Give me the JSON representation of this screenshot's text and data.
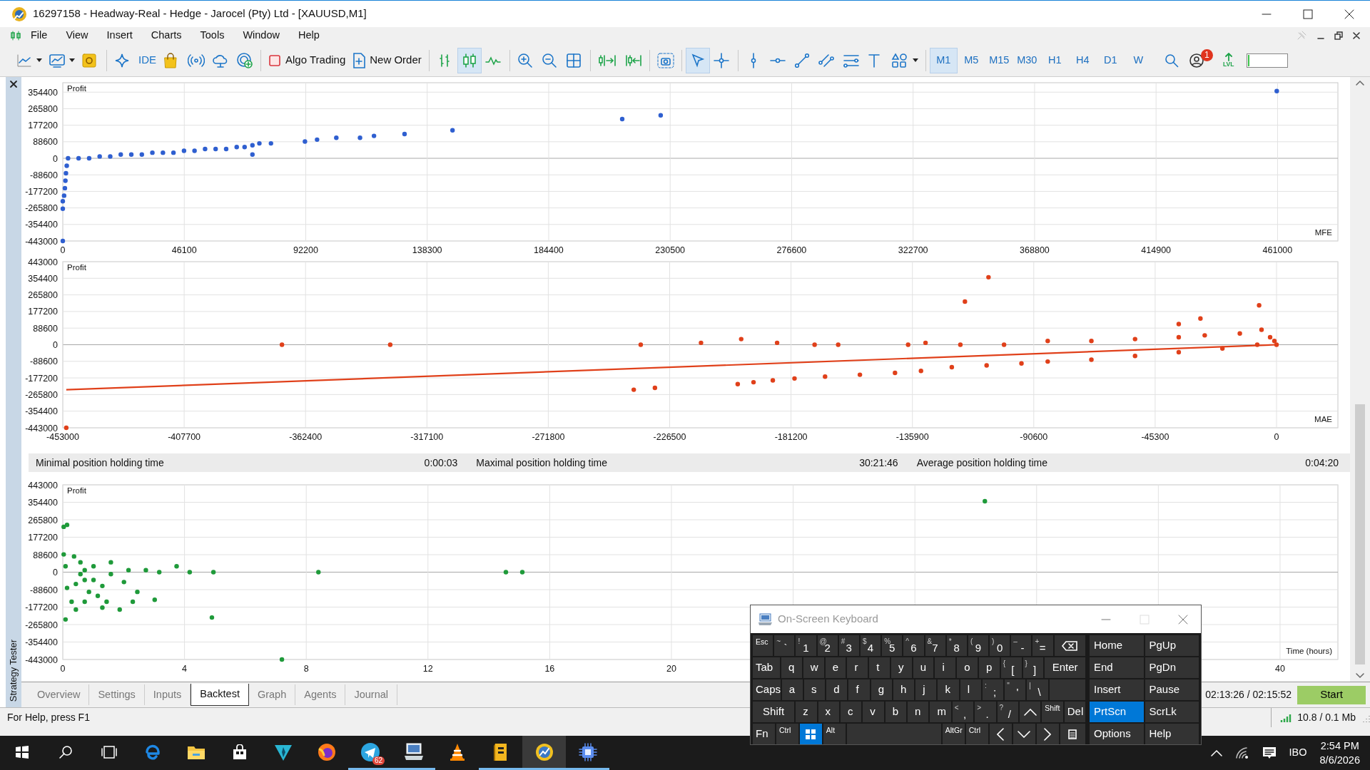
{
  "window": {
    "title": "16297158 - Headway-Real - Hedge - Jarocel (Pty) Ltd - [XAUUSD,M1]"
  },
  "menu": [
    "File",
    "View",
    "Insert",
    "Charts",
    "Tools",
    "Window",
    "Help"
  ],
  "toolbar": {
    "ide": "IDE",
    "algo_trading": {
      "label": "Algo Trading",
      "enabled": false
    },
    "new_order": "New Order",
    "chart_types": [
      {
        "selected": false
      },
      {
        "selected": true
      },
      {
        "selected": false
      }
    ],
    "cursor_tools": [
      {
        "selected": true
      },
      {
        "selected": false
      }
    ],
    "timeframes": [
      {
        "label": "M1",
        "selected": true
      },
      {
        "label": "M5",
        "selected": false
      },
      {
        "label": "M15",
        "selected": false
      },
      {
        "label": "M30",
        "selected": false
      },
      {
        "label": "H1",
        "selected": false
      },
      {
        "label": "H4",
        "selected": false
      },
      {
        "label": "D1",
        "selected": false
      },
      {
        "label": "W",
        "selected": false
      }
    ],
    "notifications_badge": "1",
    "lvl": "LVL",
    "progress": {
      "level": 0.04
    }
  },
  "sidebar": {
    "title": "Strategy Tester"
  },
  "charts": [
    {
      "chart_data": {
        "type": "scatter",
        "ylabel": "Profit",
        "xlabel": "MFE",
        "xlim": [
          0,
          483900
        ],
        "ylim": [
          -443000,
          405000
        ],
        "xticks": [
          0,
          46100,
          92200,
          138300,
          184400,
          230500,
          276600,
          322700,
          368800,
          414900,
          461000
        ],
        "yticks": [
          354400,
          265800,
          177200,
          88600,
          0,
          -88600,
          -177200,
          -265800,
          -354400,
          -443000
        ],
        "x": [
          0,
          0,
          0,
          500,
          800,
          1000,
          1200,
          1500,
          2000,
          6000,
          10000,
          14000,
          18000,
          22000,
          26000,
          30000,
          34000,
          38000,
          42000,
          46000,
          50000,
          54000,
          58000,
          62000,
          66000,
          69000,
          71970,
          71970,
          74600,
          79000,
          91900,
          96500,
          103800,
          112800,
          118100,
          129700,
          147900,
          212300,
          226900,
          460700
        ],
        "grid": true,
        "series": [
          {
            "color": "#2f5fd0",
            "values": [
              -443000,
              -270000,
              -230000,
              -200000,
              -160000,
              -120000,
              -80000,
              -40000,
              0,
              0,
              0,
              10000,
              10000,
              20000,
              20000,
              20000,
              30000,
              30000,
              30000,
              40000,
              40000,
              50000,
              50000,
              50000,
              60000,
              60000,
              20000,
              70000,
              80000,
              80000,
              90000,
              100000,
              110000,
              110000,
              120000,
              130000,
              150000,
              210000,
              230000,
              360000
            ]
          }
        ]
      }
    },
    {
      "chart_data": {
        "type": "scatter",
        "ylabel": "Profit",
        "xlabel": "MAE",
        "xlim": [
          -453000,
          22900
        ],
        "ylim": [
          -443000,
          443000
        ],
        "xticks": [
          -453000,
          -407700,
          -362400,
          -317100,
          -271800,
          -226500,
          -181200,
          -135900,
          -90600,
          -45300,
          0
        ],
        "yticks": [
          443000,
          354400,
          265800,
          177200,
          88600,
          0,
          -88600,
          -177200,
          -265800,
          -354400,
          -443000
        ],
        "x": [
          -451700,
          -371200,
          -330800,
          -237300,
          -239900,
          -232000,
          -214800,
          -199800,
          -186400,
          -172400,
          -163600,
          -201100,
          -195200,
          -188000,
          -179900,
          -168500,
          -155500,
          -142400,
          -132700,
          -121200,
          -108200,
          -95200,
          -85400,
          -69100,
          -52800,
          -36500,
          -20200,
          -7200,
          -137500,
          -131000,
          -118000,
          -101700,
          -85400,
          -69100,
          -52800,
          -36500,
          -26800,
          -13700,
          -5600,
          -2400,
          -800,
          0,
          -107500,
          -116300,
          -6500,
          -28400,
          -36500
        ],
        "grid": true,
        "series": [
          {
            "color": "#e0401a",
            "values": [
              -443000,
              0,
              0,
              0,
              -240000,
              -230000,
              10000,
              30000,
              10000,
              0,
              0,
              -210000,
              -200000,
              -190000,
              -180000,
              -170000,
              -160000,
              -150000,
              -140000,
              -120000,
              -110000,
              -100000,
              -90000,
              -80000,
              -60000,
              -40000,
              -20000,
              0,
              0,
              10000,
              0,
              0,
              20000,
              20000,
              30000,
              40000,
              50000,
              60000,
              80000,
              40000,
              20000,
              0,
              360000,
              230000,
              210000,
              140000,
              110000
            ]
          },
          {
            "color": "#e0401a",
            "type": "line",
            "values": [
              -240000,
              null,
              null,
              null,
              null,
              null,
              null,
              null,
              null,
              null,
              null,
              null,
              null,
              null,
              null,
              null,
              null,
              null,
              null,
              null,
              null,
              null,
              null,
              null,
              null,
              null,
              null,
              null,
              null,
              null,
              null,
              null,
              null,
              null,
              null,
              null,
              null,
              null,
              null,
              null,
              null,
              0,
              null,
              null,
              null,
              null,
              null
            ]
          }
        ]
      }
    },
    {
      "chart_data": {
        "type": "scatter",
        "ylabel": "Profit",
        "xlabel": "Time (hours)",
        "xlim": [
          0,
          41.9
        ],
        "ylim": [
          -443000,
          443000
        ],
        "xticks": [
          0,
          4,
          8,
          12,
          16,
          20,
          40
        ],
        "grid": true,
        "yticks": [
          443000,
          354400,
          265800,
          177200,
          88600,
          0,
          -88600,
          -177200,
          -265800,
          -354400,
          -443000
        ],
        "x": [
          0.03,
          0.14,
          0.03,
          0.09,
          0.14,
          0.09,
          0.29,
          0.43,
          0.58,
          0.72,
          0.86,
          1.01,
          1.15,
          1.3,
          1.44,
          1.58,
          1.87,
          2.01,
          2.16,
          2.3,
          2.45,
          2.73,
          3.02,
          3.17,
          3.74,
          4.17,
          4.95,
          4.9,
          8.4,
          7.2,
          14.56,
          15.1,
          30.3,
          1.3,
          0.72,
          0.43,
          0.37,
          0.58,
          1.01,
          1.58,
          0.72
        ],
        "series": [
          {
            "color": "#1f9a3a",
            "values": [
              230000,
              240000,
              90000,
              30000,
              -80000,
              -240000,
              -150000,
              -60000,
              -10000,
              10000,
              -100000,
              -40000,
              -120000,
              -70000,
              -150000,
              -10000,
              -190000,
              -50000,
              10000,
              -150000,
              -100000,
              10000,
              -140000,
              0,
              30000,
              0,
              0,
              -230000,
              0,
              -443000,
              0,
              0,
              360000,
              -180000,
              -150000,
              -190000,
              80000,
              50000,
              30000,
              50000,
              -40000
            ]
          }
        ]
      }
    }
  ],
  "stats": [
    {
      "label": "Minimal position holding time",
      "value": "0:00:03"
    },
    {
      "label": "Maximal position holding time",
      "value": "30:21:46"
    },
    {
      "label": "Average position holding time",
      "value": "0:04:20"
    }
  ],
  "tabs": [
    {
      "label": "Overview",
      "selected": false
    },
    {
      "label": "Settings",
      "selected": false
    },
    {
      "label": "Inputs",
      "selected": false
    },
    {
      "label": "Backtest",
      "selected": true
    },
    {
      "label": "Graph",
      "selected": false
    },
    {
      "label": "Agents",
      "selected": false
    },
    {
      "label": "Journal",
      "selected": false
    }
  ],
  "tester": {
    "elapsed": "02:13:26 / 02:15:52",
    "start": "Start"
  },
  "status_bar": {
    "help": "For Help, press F1",
    "traffic": "10.8 / 0.1 Mb"
  },
  "keyboard": {
    "title": "On-Screen Keyboard",
    "rows": [
      [
        {
          "kind": "small",
          "label": "Esc"
        },
        {
          "kind": "key",
          "shift": "~",
          "label": "`"
        },
        {
          "kind": "key",
          "shift": "!",
          "label": "1"
        },
        {
          "kind": "key",
          "shift": "@",
          "label": "2"
        },
        {
          "kind": "key",
          "shift": "#",
          "label": "3"
        },
        {
          "kind": "key",
          "shift": "$",
          "label": "4"
        },
        {
          "kind": "key",
          "shift": "%",
          "label": "5"
        },
        {
          "kind": "key",
          "shift": "^",
          "label": "6"
        },
        {
          "kind": "key",
          "shift": "&",
          "label": "7"
        },
        {
          "kind": "key",
          "shift": "*",
          "label": "8"
        },
        {
          "kind": "key",
          "shift": "(",
          "label": "9"
        },
        {
          "kind": "key",
          "shift": ")",
          "label": "0"
        },
        {
          "kind": "key",
          "shift": "–",
          "label": "-"
        },
        {
          "kind": "key",
          "shift": "+",
          "label": "="
        },
        {
          "kind": "backspace"
        }
      ],
      [
        {
          "kind": "wide",
          "label": "Tab"
        },
        {
          "kind": "key",
          "label": "q"
        },
        {
          "kind": "key",
          "label": "w"
        },
        {
          "kind": "key",
          "label": "e"
        },
        {
          "kind": "key",
          "label": "r"
        },
        {
          "kind": "key",
          "label": "t"
        },
        {
          "kind": "key",
          "label": "y"
        },
        {
          "kind": "key",
          "label": "u"
        },
        {
          "kind": "key",
          "label": "i"
        },
        {
          "kind": "key",
          "label": "o"
        },
        {
          "kind": "key",
          "label": "p"
        },
        {
          "kind": "key",
          "shift": "{",
          "label": "["
        },
        {
          "kind": "key",
          "shift": "}",
          "label": "]"
        },
        {
          "kind": "wider",
          "label": "Enter"
        }
      ],
      [
        {
          "kind": "wide",
          "label": "Caps"
        },
        {
          "kind": "key",
          "label": "a"
        },
        {
          "kind": "key",
          "label": "s"
        },
        {
          "kind": "key",
          "label": "d"
        },
        {
          "kind": "key",
          "label": "f"
        },
        {
          "kind": "key",
          "label": "g"
        },
        {
          "kind": "key",
          "label": "h"
        },
        {
          "kind": "key",
          "label": "j"
        },
        {
          "kind": "key",
          "label": "k"
        },
        {
          "kind": "key",
          "label": "l"
        },
        {
          "kind": "key",
          "shift": ":",
          "label": ";"
        },
        {
          "kind": "key",
          "shift": "\"",
          "label": "'"
        },
        {
          "kind": "key",
          "shift": "|",
          "label": "\\"
        },
        {
          "kind": "blank"
        }
      ],
      [
        {
          "kind": "wider",
          "label": "Shift"
        },
        {
          "kind": "key",
          "label": "z"
        },
        {
          "kind": "key",
          "label": "x"
        },
        {
          "kind": "key",
          "label": "c"
        },
        {
          "kind": "key",
          "label": "v"
        },
        {
          "kind": "key",
          "label": "b"
        },
        {
          "kind": "key",
          "label": "n"
        },
        {
          "kind": "key",
          "label": "m"
        },
        {
          "kind": "key",
          "shift": "<",
          "label": ","
        },
        {
          "kind": "key",
          "shift": ">",
          "label": "."
        },
        {
          "kind": "key",
          "shift": "?",
          "label": "/"
        },
        {
          "kind": "up"
        },
        {
          "kind": "small",
          "label": "Shift"
        },
        {
          "kind": "key",
          "label": "Del"
        }
      ],
      [
        {
          "kind": "key",
          "label": "Fn"
        },
        {
          "kind": "small",
          "label": "Ctrl"
        },
        {
          "kind": "windows"
        },
        {
          "kind": "small",
          "label": "Alt"
        },
        {
          "kind": "space"
        },
        {
          "kind": "small",
          "label": "AltGr"
        },
        {
          "kind": "small",
          "label": "Ctrl"
        },
        {
          "kind": "left"
        },
        {
          "kind": "down"
        },
        {
          "kind": "right"
        },
        {
          "kind": "menu"
        }
      ]
    ],
    "nav_keys": [
      {
        "label": "Home",
        "selected": false
      },
      {
        "label": "PgUp",
        "selected": false
      },
      {
        "label": "End",
        "selected": false
      },
      {
        "label": "PgDn",
        "selected": false
      },
      {
        "label": "Insert",
        "selected": false
      },
      {
        "label": "Pause",
        "selected": false
      },
      {
        "label": "PrtScn",
        "selected": true
      },
      {
        "label": "ScrLk",
        "selected": false
      },
      {
        "label": "Options",
        "selected": false
      },
      {
        "label": "Help",
        "selected": false
      }
    ]
  },
  "taskbar": {
    "apps": [
      {
        "running": false,
        "active": false
      },
      {
        "running": false,
        "active": false
      },
      {
        "running": false,
        "active": false
      },
      {
        "running": false,
        "active": false
      },
      {
        "running": false,
        "active": false
      },
      {
        "running": false,
        "active": false
      },
      {
        "running": true,
        "active": false,
        "badge": "62"
      },
      {
        "running": true,
        "active": false
      },
      {
        "running": false,
        "active": false
      },
      {
        "running": true,
        "active": false
      },
      {
        "running": true,
        "active": true
      },
      {
        "running": true,
        "active": false
      }
    ],
    "language": "IBO",
    "time": "2:54 PM",
    "date": "8/6/2026"
  }
}
